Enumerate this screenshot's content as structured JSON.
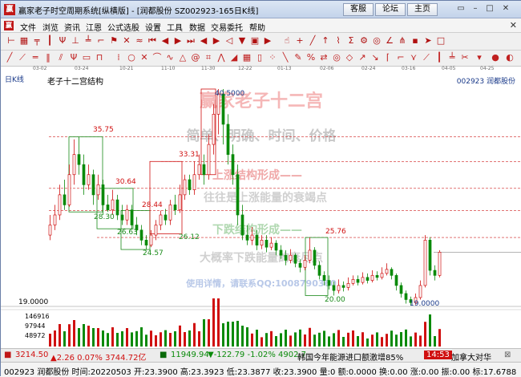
{
  "titlebar": {
    "title": "赢家老子时空周期系统[纵横版] - [润都股份  SZ002923-165日K线]",
    "buttons": [
      "客服",
      "论坛",
      "主页"
    ]
  },
  "menubar": {
    "items": [
      "文件",
      "浏览",
      "资讯",
      "江恩",
      "公式选股",
      "设置",
      "工具",
      "数据",
      "交易委托",
      "帮助"
    ]
  },
  "date_axis": [
    "03-02",
    "03-24",
    "10-21",
    "11-10",
    "11-30",
    "12-22",
    "01-13",
    "02-06",
    "03-07",
    "03-25",
    "02-24",
    "03-16",
    "04-05",
    "04-25"
  ],
  "chart": {
    "kline_label": "日K线",
    "title": "老子十二宫结构",
    "stock": "002923 润都股份",
    "watermark_title": "赢家老子十二宫",
    "watermark_lines": [
      "简单、明确、时间、价格",
      "上涨结构形成——",
      "往往是上涨能量的衰竭点",
      "下跌结构形成——",
      "大概率下跌能量的衰尽点",
      "使用详情，请联系QQ:1008790360"
    ],
    "price_labels": [
      "40.5000",
      "35.75",
      "33.31",
      "30.64",
      "28.44",
      "28.30",
      "26.63",
      "26.12",
      "25.76",
      "24.57",
      "20.00",
      "19.0000",
      "19.0000"
    ],
    "volume_labels": [
      "146916",
      "97944",
      "48972"
    ]
  },
  "status1": {
    "sh_index": "3214.50",
    "sh_change": "▲2.26 0.07% 3744.72亿",
    "sz_index": "11949.94",
    "sz_change": "▼-122.79 -1.02% 4902.7",
    "news": "韩国今年能源进口额激增85%",
    "time": "14:53",
    "ad": "加拿大对华"
  },
  "status2": {
    "line": "002923 润都股份 时间:20220503 开:23.3900 高:23.3923 低:23.3877 收:23.3900 量:0 额:0.0000 换:0.00 涨:0.00 振:0.00 标:17.6788"
  },
  "colors": {
    "up": "#d01010",
    "down": "#0a8a0a",
    "grid_red": "#d02020",
    "box_red": "#d01010",
    "box_green": "#1a8a1a",
    "watermark": "#e88a8a"
  }
}
